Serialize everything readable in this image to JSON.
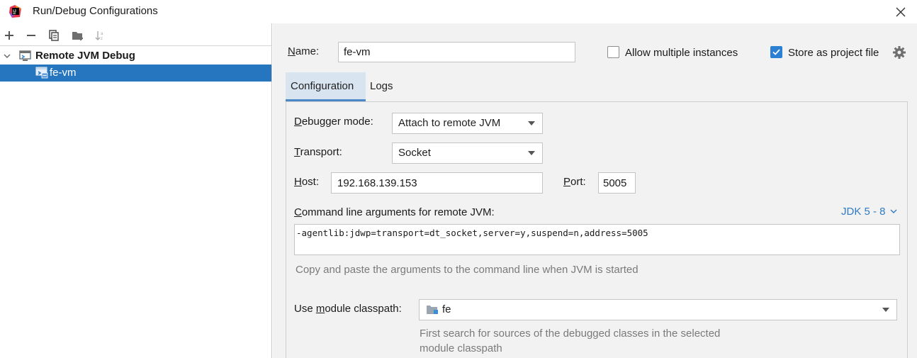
{
  "window": {
    "title": "Run/Debug Configurations"
  },
  "toolbar": {
    "icons": [
      "add-icon",
      "remove-icon",
      "copy-icon",
      "folder-add-icon",
      "sort-icon"
    ]
  },
  "tree": {
    "group_label": "Remote JVM Debug",
    "item_label": "fe-vm"
  },
  "form": {
    "name_label": "Name:",
    "name_value": "fe-vm",
    "allow_multiple_label": "Allow multiple instances",
    "allow_multiple_checked": false,
    "store_project_label": "Store as project file",
    "store_project_checked": true
  },
  "tabs": [
    {
      "label": "Configuration",
      "active": true
    },
    {
      "label": "Logs",
      "active": false
    }
  ],
  "config": {
    "debugger_mode_label": "Debugger mode:",
    "debugger_mode_value": "Attach to remote JVM",
    "transport_label": "Transport:",
    "transport_value": "Socket",
    "host_label": "Host:",
    "host_value": "192.168.139.153",
    "port_label": "Port:",
    "port_value": "5005",
    "cmd_label": "Command line arguments for remote JVM:",
    "jdk_link": "JDK 5 - 8",
    "cmd_value": "-agentlib:jdwp=transport=dt_socket,server=y,suspend=n,address=5005",
    "cmd_hint": "Copy and paste the arguments to the command line when JVM is started",
    "module_label": "Use module classpath:",
    "module_value": "fe",
    "module_hint_line1": "First search for sources of the debugged classes in the selected",
    "module_hint_line2": "module classpath"
  },
  "colors": {
    "selection": "#2675bf",
    "accent": "#2b80d4",
    "link": "#2f7bc4",
    "panel_bg": "#f2f2f2"
  }
}
